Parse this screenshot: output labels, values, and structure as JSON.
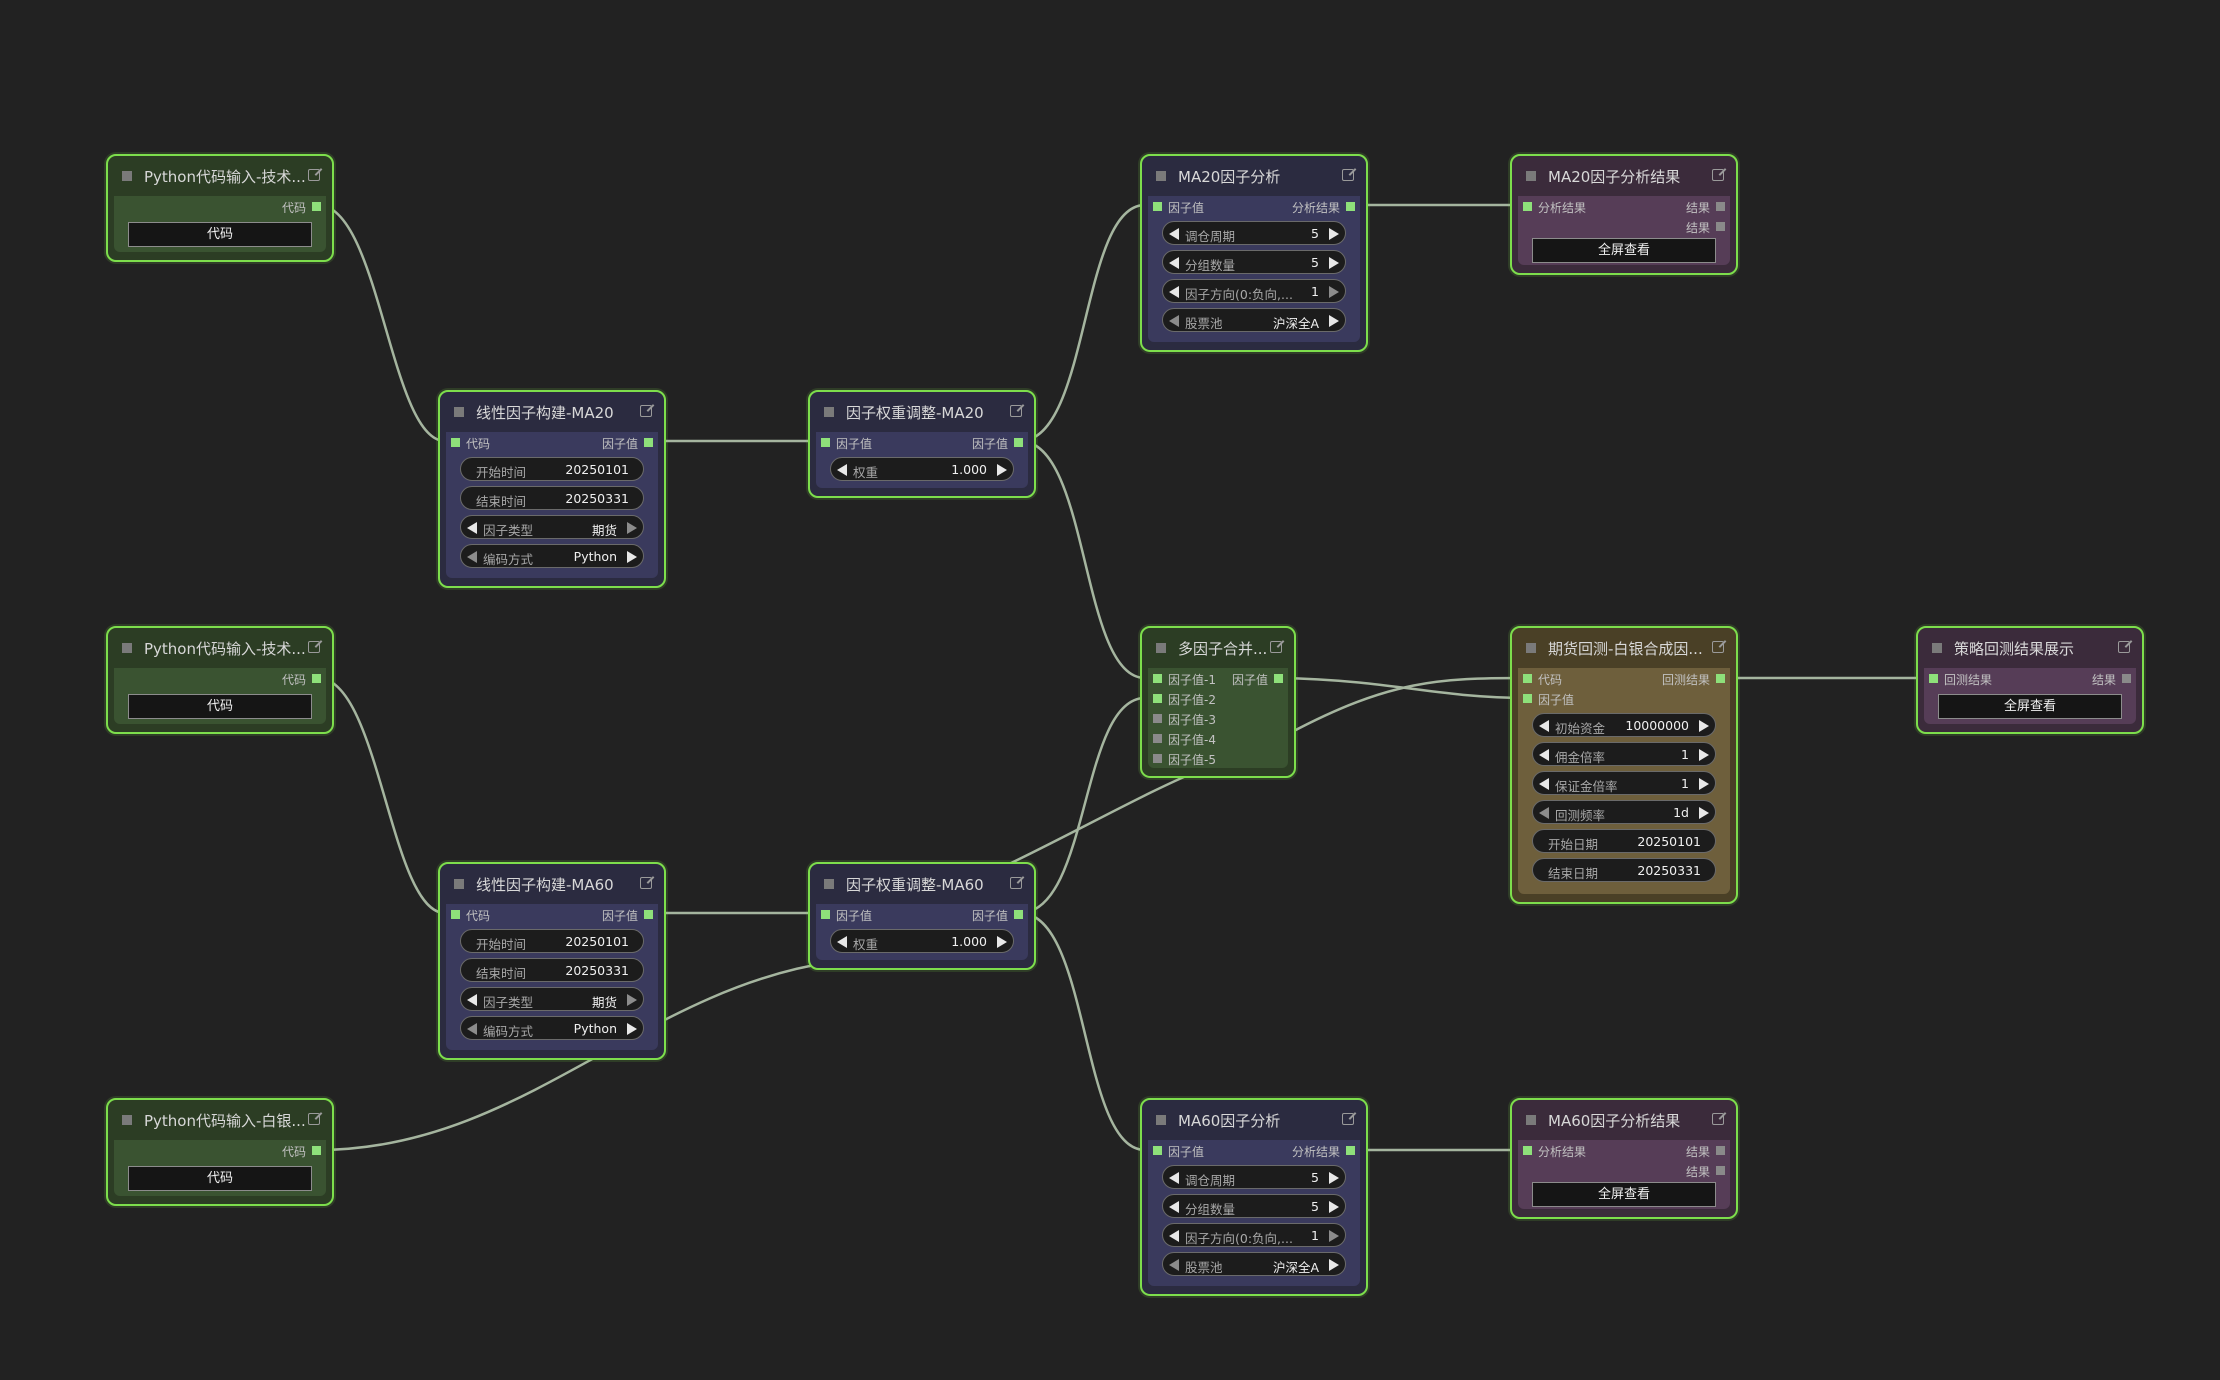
{
  "canvas": {
    "background": "#222222",
    "node_border": "#7dde4c",
    "wire_color": "#a5b59f"
  },
  "nodes": {
    "py1": {
      "title": "Python代码输入-技术...",
      "out_label": "代码",
      "button": "代码"
    },
    "py2": {
      "title": "Python代码输入-技术...",
      "out_label": "代码",
      "button": "代码"
    },
    "py3": {
      "title": "Python代码输入-白银...",
      "out_label": "代码",
      "button": "代码"
    },
    "lin1": {
      "title": "线性因子构建-MA20",
      "in_label": "代码",
      "out_label": "因子值",
      "fields": [
        {
          "label": "开始时间",
          "value": "20250101"
        },
        {
          "label": "结束时间",
          "value": "20250331"
        },
        {
          "label": "因子类型",
          "value": "期货"
        },
        {
          "label": "编码方式",
          "value": "Python"
        }
      ]
    },
    "lin2": {
      "title": "线性因子构建-MA60",
      "in_label": "代码",
      "out_label": "因子值",
      "fields": [
        {
          "label": "开始时间",
          "value": "20250101"
        },
        {
          "label": "结束时间",
          "value": "20250331"
        },
        {
          "label": "因子类型",
          "value": "期货"
        },
        {
          "label": "编码方式",
          "value": "Python"
        }
      ]
    },
    "w1": {
      "title": "因子权重调整-MA20",
      "in_label": "因子值",
      "out_label": "因子值",
      "fields": [
        {
          "label": "权重",
          "value": "1.000"
        }
      ]
    },
    "w2": {
      "title": "因子权重调整-MA60",
      "in_label": "因子值",
      "out_label": "因子值",
      "fields": [
        {
          "label": "权重",
          "value": "1.000"
        }
      ]
    },
    "an1": {
      "title": "MA20因子分析",
      "in_label": "因子值",
      "out_label": "分析结果",
      "fields": [
        {
          "label": "调仓周期",
          "value": "5"
        },
        {
          "label": "分组数量",
          "value": "5"
        },
        {
          "label": "因子方向(0:负向,...",
          "value": "1"
        },
        {
          "label": "股票池",
          "value": "沪深全A"
        }
      ]
    },
    "an2": {
      "title": "MA60因子分析",
      "in_label": "因子值",
      "out_label": "分析结果",
      "fields": [
        {
          "label": "调仓周期",
          "value": "5"
        },
        {
          "label": "分组数量",
          "value": "5"
        },
        {
          "label": "因子方向(0:负向,...",
          "value": "1"
        },
        {
          "label": "股票池",
          "value": "沪深全A"
        }
      ]
    },
    "res1": {
      "title": "MA20因子分析结果",
      "in_label": "分析结果",
      "out1": "结果",
      "out2": "结果",
      "button": "全屏查看"
    },
    "res2": {
      "title": "MA60因子分析结果",
      "in_label": "分析结果",
      "out1": "结果",
      "out2": "结果",
      "button": "全屏查看"
    },
    "merge": {
      "title": "多因子合并...",
      "out_label": "因子值",
      "inputs": [
        "因子值-1",
        "因子值-2",
        "因子值-3",
        "因子值-4",
        "因子值-5"
      ]
    },
    "bt": {
      "title": "期货回测-白银合成因...",
      "in1": "代码",
      "in2": "因子值",
      "out_label": "回测结果",
      "fields": [
        {
          "label": "初始资金",
          "value": "10000000"
        },
        {
          "label": "佣金倍率",
          "value": "1"
        },
        {
          "label": "保证金倍率",
          "value": "1"
        },
        {
          "label": "回测频率",
          "value": "1d"
        },
        {
          "label": "开始日期",
          "value": "20250101"
        },
        {
          "label": "结束日期",
          "value": "20250331"
        }
      ]
    },
    "show": {
      "title": "策略回测结果展示",
      "in_label": "回测结果",
      "out_label": "结果",
      "button": "全屏查看"
    }
  }
}
